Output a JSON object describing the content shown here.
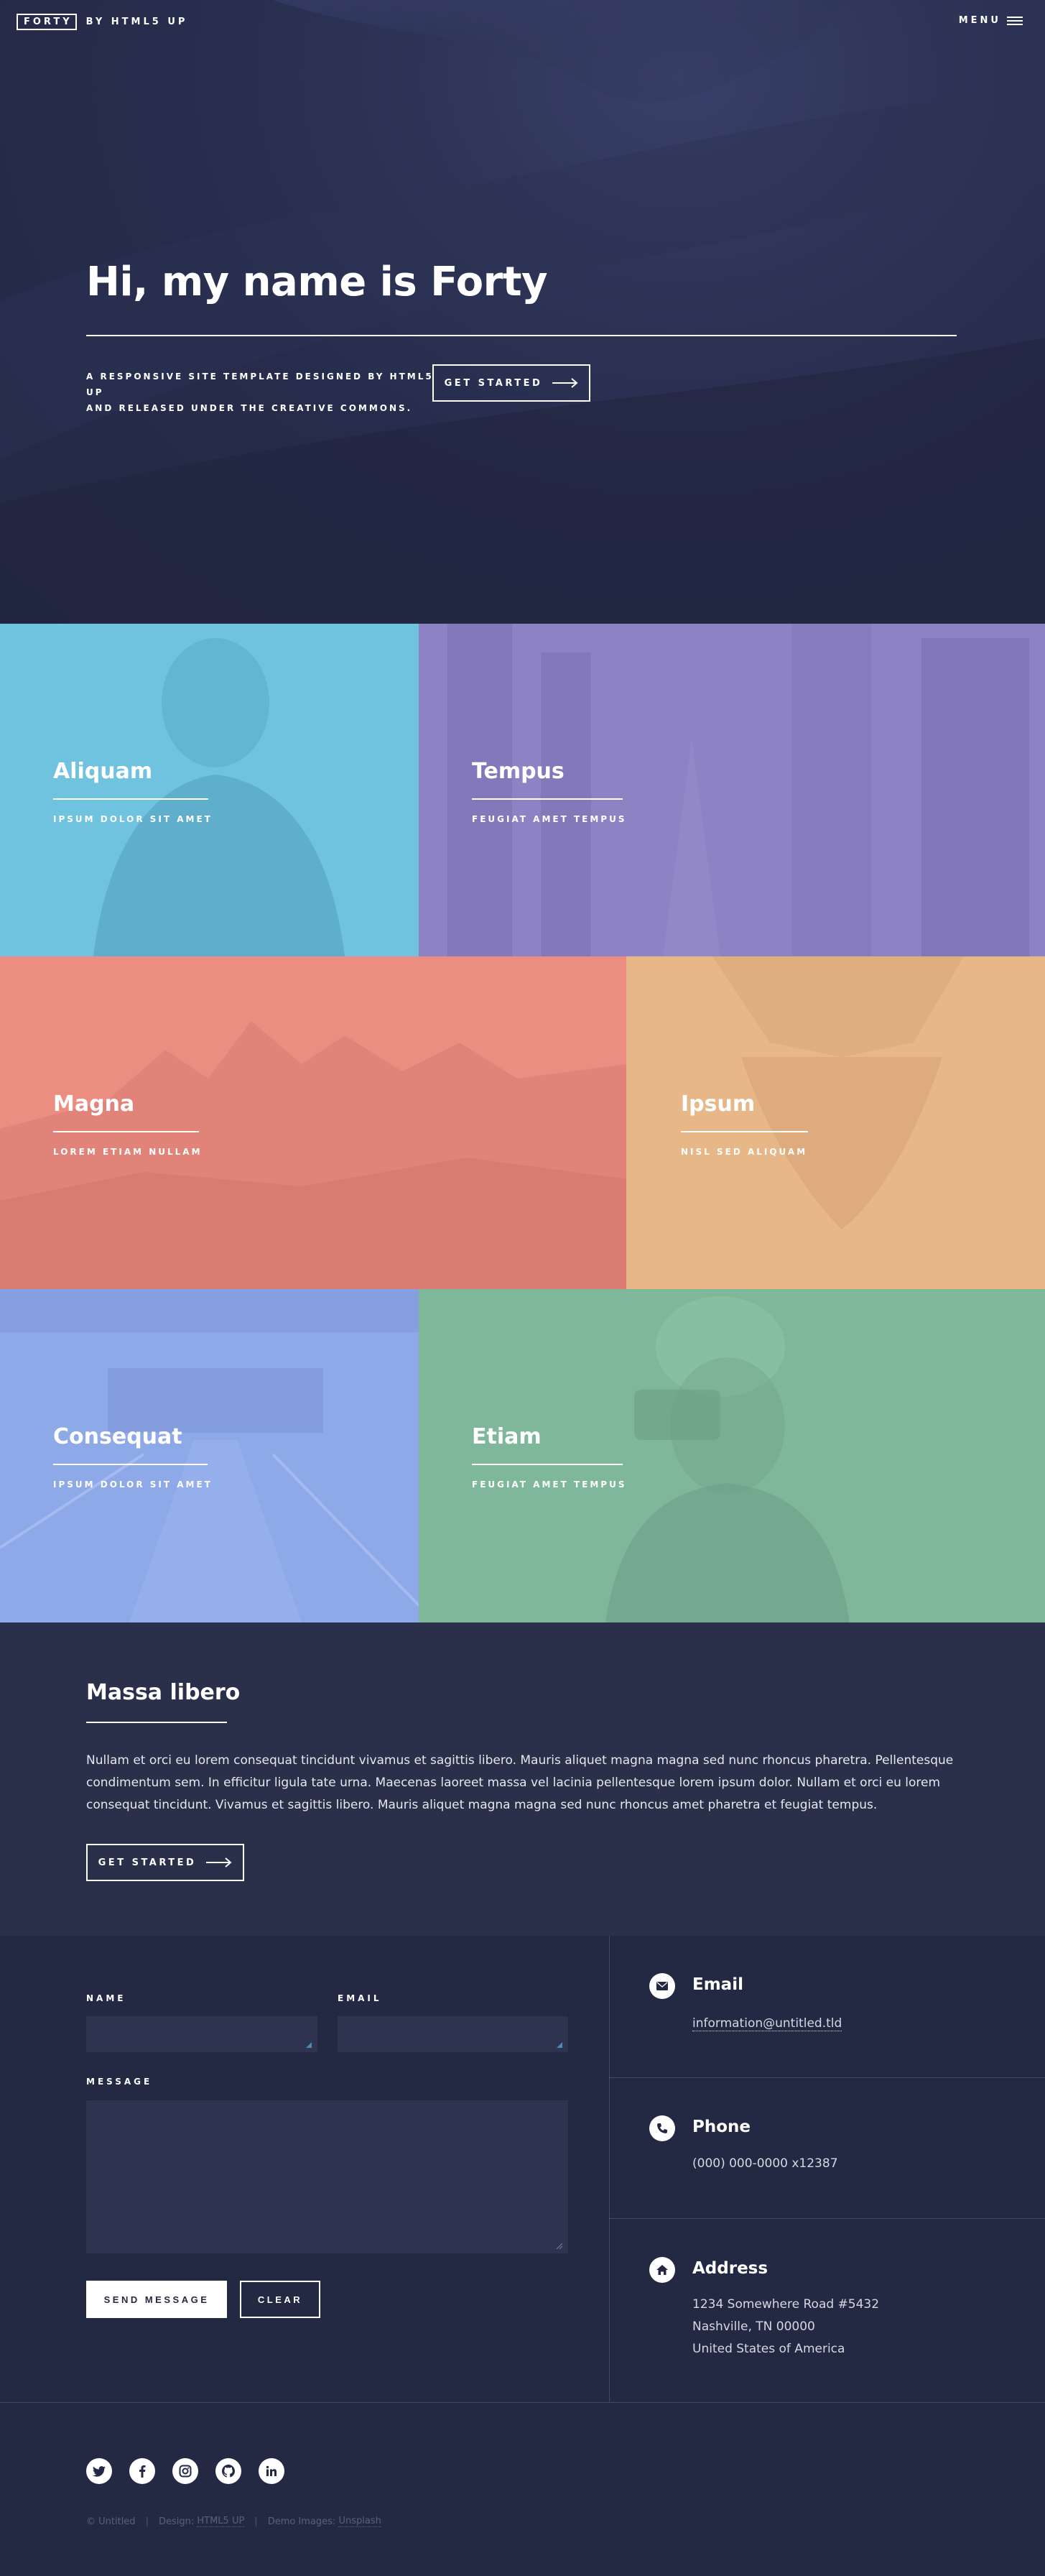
{
  "header": {
    "logo": "FORTY",
    "tagline": "BY HTML5 UP",
    "menu_label": "MENU"
  },
  "banner": {
    "title": "Hi, my name is Forty",
    "subtitle_line1": "A RESPONSIVE SITE TEMPLATE DESIGNED BY HTML5 UP",
    "subtitle_line2": "AND RELEASED UNDER THE CREATIVE COMMONS.",
    "cta_label": "GET STARTED"
  },
  "tiles": [
    {
      "title": "Aliquam",
      "subtitle": "IPSUM DOLOR SIT AMET",
      "color": "#6fc3df"
    },
    {
      "title": "Tempus",
      "subtitle": "FEUGIAT AMET TEMPUS",
      "color": "#8d82c4"
    },
    {
      "title": "Magna",
      "subtitle": "LOREM ETIAM NULLAM",
      "color": "#ec8d81"
    },
    {
      "title": "Ipsum",
      "subtitle": "NISL SED ALIQUAM",
      "color": "#e7b788"
    },
    {
      "title": "Consequat",
      "subtitle": "IPSUM DOLOR SIT AMET",
      "color": "#8ea9e8"
    },
    {
      "title": "Etiam",
      "subtitle": "FEUGIAT AMET TEMPUS",
      "color": "#87c5a4"
    }
  ],
  "intro": {
    "title": "Massa libero",
    "body": "Nullam et orci eu lorem consequat tincidunt vivamus et sagittis libero. Mauris aliquet magna magna sed nunc rhoncus pharetra. Pellentesque condimentum sem. In efficitur ligula tate urna. Maecenas laoreet massa vel lacinia pellentesque lorem ipsum dolor. Nullam et orci eu lorem consequat tincidunt. Vivamus et sagittis libero. Mauris aliquet magna magna sed nunc rhoncus amet pharetra et feugiat tempus.",
    "cta_label": "GET STARTED"
  },
  "form": {
    "name_label": "NAME",
    "email_label": "EMAIL",
    "message_label": "MESSAGE",
    "name_value": "",
    "email_value": "",
    "message_value": "",
    "send_label": "SEND MESSAGE",
    "clear_label": "CLEAR"
  },
  "contact_info": {
    "email_heading": "Email",
    "email_value": "information@untitled.tld",
    "phone_heading": "Phone",
    "phone_value": "(000) 000-0000 x12387",
    "address_heading": "Address",
    "address_line1": "1234 Somewhere Road #5432",
    "address_line2": "Nashville, TN 00000",
    "address_line3": "United States of America"
  },
  "footer": {
    "social_icons": [
      "twitter-icon",
      "facebook-icon",
      "instagram-icon",
      "github-icon",
      "linkedin-icon"
    ],
    "copyright": "© Untitled",
    "design_prefix": "Design:",
    "design_link": "HTML5 UP",
    "demo_prefix": "Demo Images:",
    "demo_link": "Unsplash"
  },
  "colors": {
    "background": "#242943",
    "section_alt": "#2a2f4a",
    "field": "#2e3450",
    "text": "#ffffff"
  }
}
